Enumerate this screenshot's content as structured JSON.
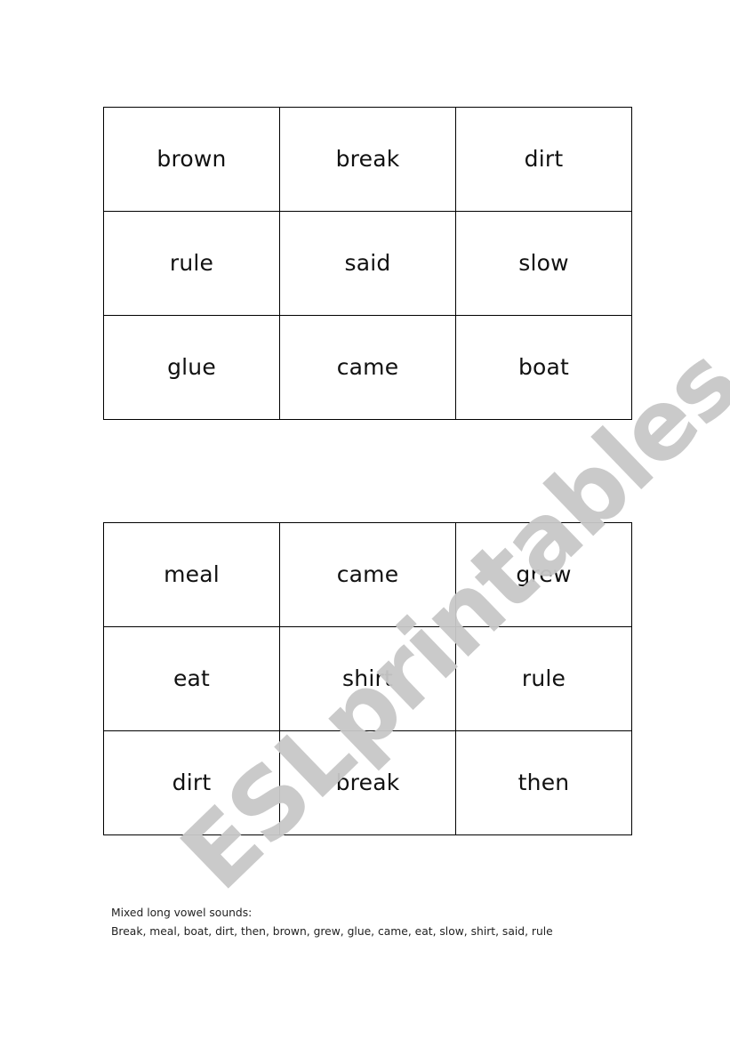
{
  "watermark": "ESLprintables.com",
  "grids": [
    {
      "rows": [
        [
          "brown",
          "break",
          "dirt"
        ],
        [
          "rule",
          "said",
          "slow"
        ],
        [
          "glue",
          "came",
          "boat"
        ]
      ]
    },
    {
      "rows": [
        [
          "meal",
          "came",
          "grew"
        ],
        [
          "eat",
          "shirt",
          "rule"
        ],
        [
          "dirt",
          "break",
          "then"
        ]
      ]
    }
  ],
  "wordlist": {
    "title": "Mixed long vowel sounds:",
    "words": "Break, meal, boat, dirt, then, brown, grew, glue, came, eat, slow, shirt, said, rule"
  }
}
